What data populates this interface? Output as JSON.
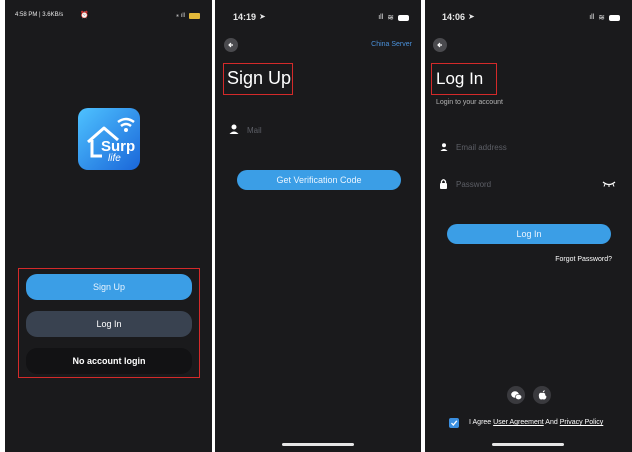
{
  "screen1": {
    "status_text": "4:58 PM | 3.6KB/s",
    "logo_line1": "Surp",
    "logo_line2": "life",
    "signup_label": "Sign Up",
    "login_label": "Log In",
    "no_account_label": "No account login"
  },
  "screen2": {
    "time": "14:19",
    "server_link": "China Server",
    "title": "Sign Up",
    "mail_placeholder": "Mail",
    "verify_button": "Get Verification Code"
  },
  "screen3": {
    "time": "14:06",
    "title": "Log In",
    "subtitle": "Login to your account",
    "email_placeholder": "Email address",
    "password_placeholder": "Password",
    "login_button": "Log In",
    "forgot_link": "Forgot Password?",
    "agree_prefix": "I Agree",
    "user_agreement": "User Agreement",
    "and_text": "And",
    "privacy_policy": "Privacy Policy"
  },
  "colors": {
    "accent": "#3b9ee6",
    "highlight_box": "#d42a2a",
    "background": "#1a1a1c"
  },
  "icons": [
    "back-icon",
    "wifi-icon",
    "battery-icon",
    "signal-icon",
    "user-icon",
    "lock-icon",
    "eye-closed-icon",
    "wechat-icon",
    "apple-icon",
    "checkbox-icon",
    "location-arrow-icon",
    "alarm-icon"
  ]
}
